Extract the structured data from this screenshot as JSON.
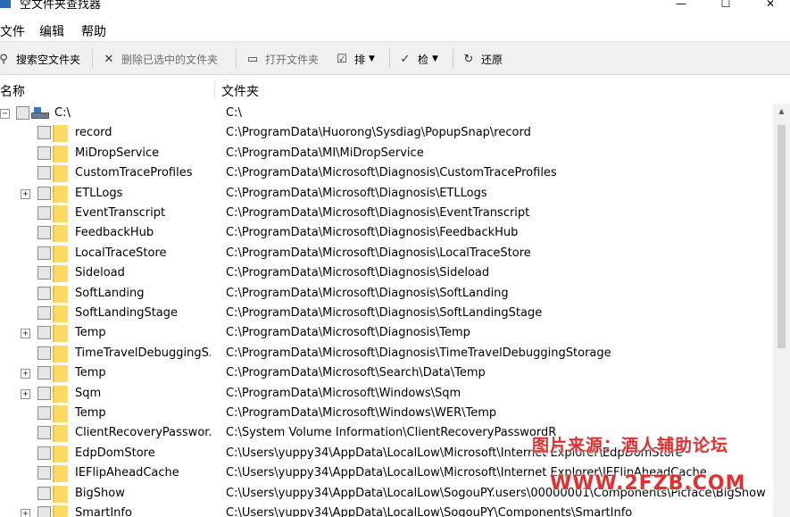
{
  "window": {
    "title": "空文件夹查找器",
    "controls": {
      "minimize": "—",
      "maximize": "☐",
      "close": "✕"
    }
  },
  "menu": [
    "文件",
    "编辑",
    "帮助"
  ],
  "toolbar": {
    "search_label": "搜索空文件夹",
    "delete_label": "删除已选中的文件夹",
    "open_label": "打开文件夹",
    "sort_label": "排",
    "check_label": "检",
    "restore_label": "还原"
  },
  "columns": {
    "name": "名称",
    "folder": "文件夹"
  },
  "root": {
    "name": "C:\\",
    "path": "C:\\"
  },
  "rows": [
    {
      "name": "record",
      "path": "C:\\ProgramData\\Huorong\\Sysdiag\\PopupSnap\\record",
      "expandable": false
    },
    {
      "name": "MiDropService",
      "path": "C:\\ProgramData\\MI\\MiDropService",
      "expandable": false
    },
    {
      "name": "CustomTraceProfiles",
      "path": "C:\\ProgramData\\Microsoft\\Diagnosis\\CustomTraceProfiles",
      "expandable": false
    },
    {
      "name": "ETLLogs",
      "path": "C:\\ProgramData\\Microsoft\\Diagnosis\\ETLLogs",
      "expandable": true
    },
    {
      "name": "EventTranscript",
      "path": "C:\\ProgramData\\Microsoft\\Diagnosis\\EventTranscript",
      "expandable": false
    },
    {
      "name": "FeedbackHub",
      "path": "C:\\ProgramData\\Microsoft\\Diagnosis\\FeedbackHub",
      "expandable": false
    },
    {
      "name": "LocalTraceStore",
      "path": "C:\\ProgramData\\Microsoft\\Diagnosis\\LocalTraceStore",
      "expandable": false
    },
    {
      "name": "Sideload",
      "path": "C:\\ProgramData\\Microsoft\\Diagnosis\\Sideload",
      "expandable": false
    },
    {
      "name": "SoftLanding",
      "path": "C:\\ProgramData\\Microsoft\\Diagnosis\\SoftLanding",
      "expandable": false
    },
    {
      "name": "SoftLandingStage",
      "path": "C:\\ProgramData\\Microsoft\\Diagnosis\\SoftLandingStage",
      "expandable": false
    },
    {
      "name": "Temp",
      "path": "C:\\ProgramData\\Microsoft\\Diagnosis\\Temp",
      "expandable": true
    },
    {
      "name": "TimeTravelDebuggingS...",
      "path": "C:\\ProgramData\\Microsoft\\Diagnosis\\TimeTravelDebuggingStorage",
      "expandable": false
    },
    {
      "name": "Temp",
      "path": "C:\\ProgramData\\Microsoft\\Search\\Data\\Temp",
      "expandable": true
    },
    {
      "name": "Sqm",
      "path": "C:\\ProgramData\\Microsoft\\Windows\\Sqm",
      "expandable": true
    },
    {
      "name": "Temp",
      "path": "C:\\ProgramData\\Microsoft\\Windows\\WER\\Temp",
      "expandable": false
    },
    {
      "name": "ClientRecoveryPasswor...",
      "path": "C:\\System Volume Information\\ClientRecoveryPasswordR",
      "expandable": false
    },
    {
      "name": "EdpDomStore",
      "path": "C:\\Users\\yuppy34\\AppData\\LocalLow\\Microsoft\\Internet Explorer\\EdpDomStore",
      "expandable": false
    },
    {
      "name": "IEFlipAheadCache",
      "path": "C:\\Users\\yuppy34\\AppData\\LocalLow\\Microsoft\\Internet Explorer\\IEFlipAheadCache",
      "expandable": false
    },
    {
      "name": "BigShow",
      "path": "C:\\Users\\yuppy34\\AppData\\LocalLow\\SogouPY.users\\00000001\\Components\\Picface\\BigShow",
      "expandable": false
    },
    {
      "name": "SmartInfo",
      "path": "C:\\Users\\yuppy34\\AppData\\LocalLow\\SogouPY\\Components\\SmartInfo",
      "expandable": true
    }
  ],
  "watermark": {
    "line1": "图片来源：酒人辅助论坛",
    "line2": "WWW.2FZB.COM"
  }
}
